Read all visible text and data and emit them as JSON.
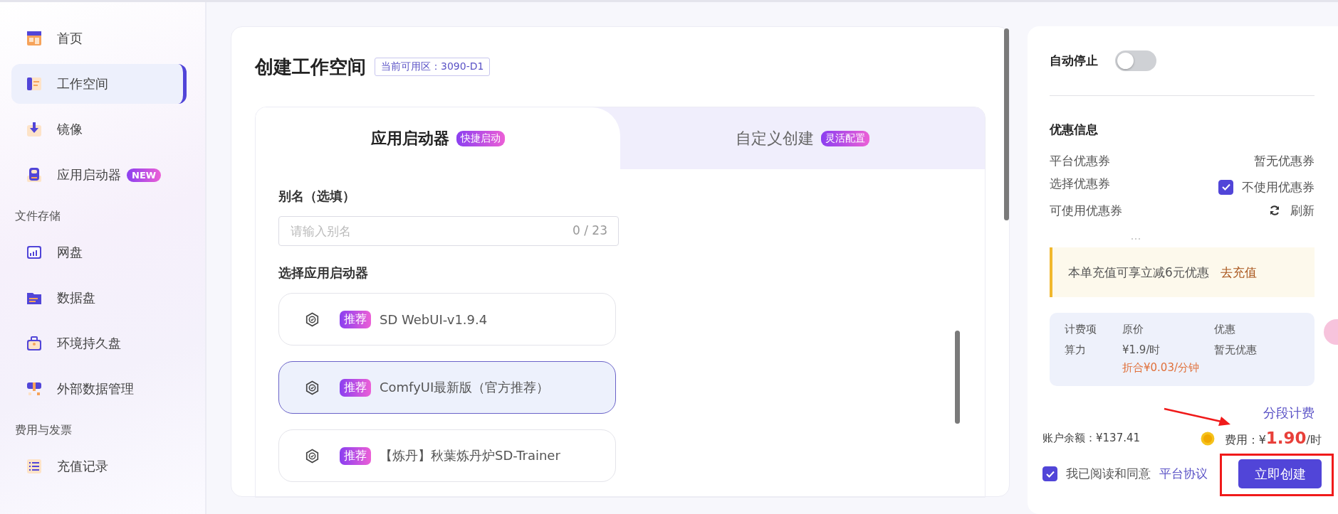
{
  "sidebar": {
    "items": [
      {
        "kind": "item",
        "label": "首页",
        "selected": false
      },
      {
        "kind": "item",
        "label": "工作空间",
        "selected": true
      },
      {
        "kind": "item",
        "label": "镜像",
        "selected": false
      },
      {
        "kind": "item",
        "label": "应用启动器",
        "selected": false,
        "badge": "NEW"
      },
      {
        "kind": "section",
        "label": "文件存储"
      },
      {
        "kind": "item",
        "label": "网盘",
        "selected": false
      },
      {
        "kind": "item",
        "label": "数据盘",
        "selected": false
      },
      {
        "kind": "item",
        "label": "环境持久盘",
        "selected": false
      },
      {
        "kind": "item",
        "label": "外部数据管理",
        "selected": false
      },
      {
        "kind": "section",
        "label": "费用与发票"
      },
      {
        "kind": "item",
        "label": "充值记录",
        "selected": false
      }
    ]
  },
  "main": {
    "title": "创建工作空间",
    "zone_badge": "当前可用区：3090-D1",
    "tabs": [
      {
        "label": "应用启动器",
        "tag": "快捷启动",
        "selected": true
      },
      {
        "label": "自定义创建",
        "tag": "灵活配置",
        "selected": false
      }
    ],
    "alias_label": "别名（选填）",
    "alias_field": {
      "placeholder": "请输入别名",
      "counter": "0 / 23"
    },
    "launcher_label": "选择应用启动器",
    "launchers": [
      {
        "tag": "推荐",
        "name": "SD WebUI-v1.9.4",
        "selected": false
      },
      {
        "tag": "推荐",
        "name": "ComfyUI最新版（官方推荐）",
        "selected": true
      },
      {
        "tag": "推荐",
        "name": "【炼丹】秋葉炼丹炉SD-Trainer",
        "selected": false
      }
    ]
  },
  "order": {
    "auto_stop": {
      "label": "自动停止",
      "on": false
    },
    "discount": {
      "title": "优惠信息",
      "platform_label": "平台优惠券",
      "platform_value": "暂无优惠券",
      "select_label": "选择优惠券",
      "no_coupon": {
        "label": "不使用优惠券",
        "checked": true
      },
      "available_label": "可使用优惠券",
      "refresh": "刷新"
    },
    "notice": {
      "text": "本单充值可享立减6元优惠",
      "link": "去充值"
    },
    "price_table": {
      "columns": [
        "计费项",
        "原价",
        "优惠"
      ],
      "rows": [
        [
          "算力",
          "¥1.9/时",
          "暂无优惠"
        ]
      ],
      "note": "折合¥0.03/分钟"
    },
    "segment_link": "分段计费",
    "balance": "账户余额：¥137.41",
    "fee": {
      "label": "费用：¥",
      "amount": "1.90",
      "unit": "/时"
    },
    "agreement": {
      "checked": true,
      "text": "我已阅读和同意",
      "link": "平台协议"
    },
    "create_button": "立即创建"
  }
}
